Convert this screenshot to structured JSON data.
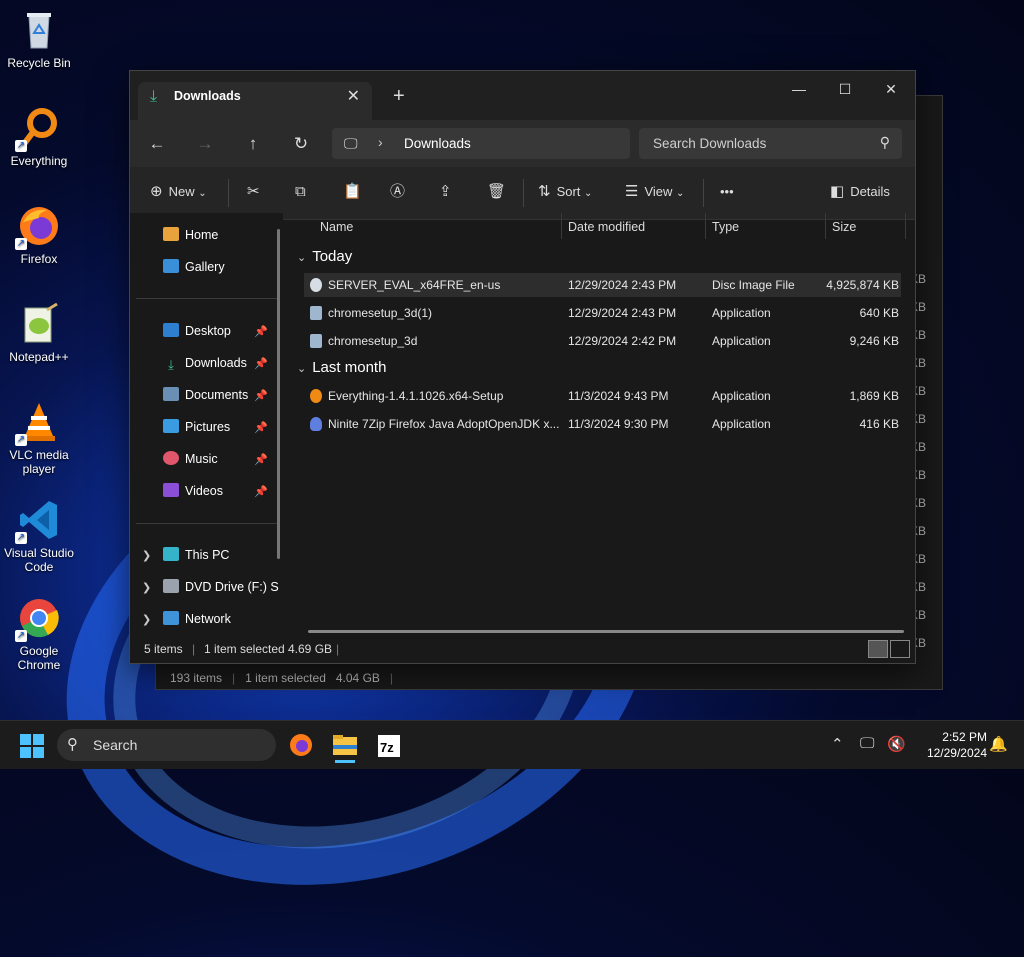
{
  "desktop": {
    "icons": [
      {
        "label": "Recycle Bin",
        "icon": "recycle-bin-icon"
      },
      {
        "label": "Everything",
        "icon": "everything-icon"
      },
      {
        "label": "Firefox",
        "icon": "firefox-icon"
      },
      {
        "label": "Notepad++",
        "icon": "notepad-plus-plus-icon"
      },
      {
        "label": "VLC media player",
        "icon": "vlc-icon"
      },
      {
        "label": "Visual Studio Code",
        "icon": "vscode-icon"
      },
      {
        "label": "Google Chrome",
        "icon": "chrome-icon"
      }
    ]
  },
  "background_window": {
    "size_suffix": "KB",
    "status": {
      "items": "193 items",
      "selected": "1 item selected",
      "size": "4.04 GB"
    }
  },
  "window": {
    "tab_title": "Downloads",
    "address": {
      "crumb": "Downloads"
    },
    "search": {
      "placeholder": "Search Downloads"
    },
    "toolbar": {
      "new_label": "New",
      "sort_label": "Sort",
      "view_label": "View",
      "more_label": "•••",
      "details_label": "Details"
    },
    "sidebar": {
      "home": "Home",
      "gallery": "Gallery",
      "pinned": [
        "Desktop",
        "Downloads",
        "Documents",
        "Pictures",
        "Music",
        "Videos"
      ],
      "this_pc": "This PC",
      "dvd": "DVD Drive (F:) S",
      "network": "Network"
    },
    "columns": {
      "name": "Name",
      "date": "Date modified",
      "type": "Type",
      "size": "Size"
    },
    "groups": [
      {
        "label": "Today",
        "files": [
          {
            "name": "SERVER_EVAL_x64FRE_en-us",
            "date": "12/29/2024 2:43 PM",
            "type": "Disc Image File",
            "size": "4,925,874 KB",
            "selected": true
          },
          {
            "name": "chromesetup_3d(1)",
            "date": "12/29/2024 2:43 PM",
            "type": "Application",
            "size": "640 KB"
          },
          {
            "name": "chromesetup_3d",
            "date": "12/29/2024 2:42 PM",
            "type": "Application",
            "size": "9,246 KB"
          }
        ]
      },
      {
        "label": "Last month",
        "files": [
          {
            "name": "Everything-1.4.1.1026.x64-Setup",
            "date": "11/3/2024 9:43 PM",
            "type": "Application",
            "size": "1,869 KB"
          },
          {
            "name": "Ninite 7Zip Firefox Java AdoptOpenJDK x...",
            "date": "11/3/2024 9:30 PM",
            "type": "Application",
            "size": "416 KB"
          }
        ]
      }
    ],
    "status": {
      "items": "5 items",
      "selected": "1 item selected",
      "size": "4.69 GB"
    }
  },
  "taskbar": {
    "search_label": "Search",
    "apps": [
      "firefox-icon",
      "file-explorer-icon",
      "7zip-icon"
    ],
    "time": "2:52 PM",
    "date": "12/29/2024"
  },
  "colors": {
    "accent": "#4cc2ff",
    "selection": "#2d2d2d",
    "window_bg": "#191919"
  }
}
